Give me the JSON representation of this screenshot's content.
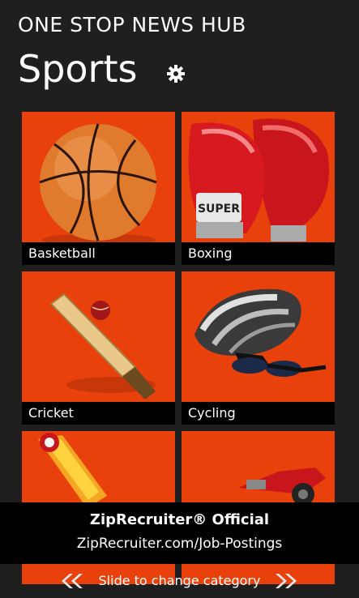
{
  "header": {
    "app_title": "ONE STOP NEWS HUB",
    "page_title": "Sports",
    "settings_icon": "gear-icon"
  },
  "tiles": [
    {
      "label": "Basketball",
      "icon": "basketball-image"
    },
    {
      "label": "Boxing",
      "icon": "boxing-glove-image",
      "image_text": "SUPER"
    },
    {
      "label": "Cricket",
      "icon": "cricket-bat-image"
    },
    {
      "label": "Cycling",
      "icon": "cycling-helmet-image"
    },
    {
      "label": "",
      "icon": "racing-image"
    },
    {
      "label": "",
      "icon": "race-car-image"
    }
  ],
  "ad": {
    "title": "ZipRecruiter® Official",
    "url": "ZipRecruiter.com/Job-Postings"
  },
  "footer": {
    "text": "Slide to change category",
    "left_icon": "double-chevron-left-icon",
    "right_icon": "double-chevron-right-icon"
  },
  "colors": {
    "background": "#1f1f1f",
    "tile": "#e8410c",
    "label_bar": "#000000"
  }
}
